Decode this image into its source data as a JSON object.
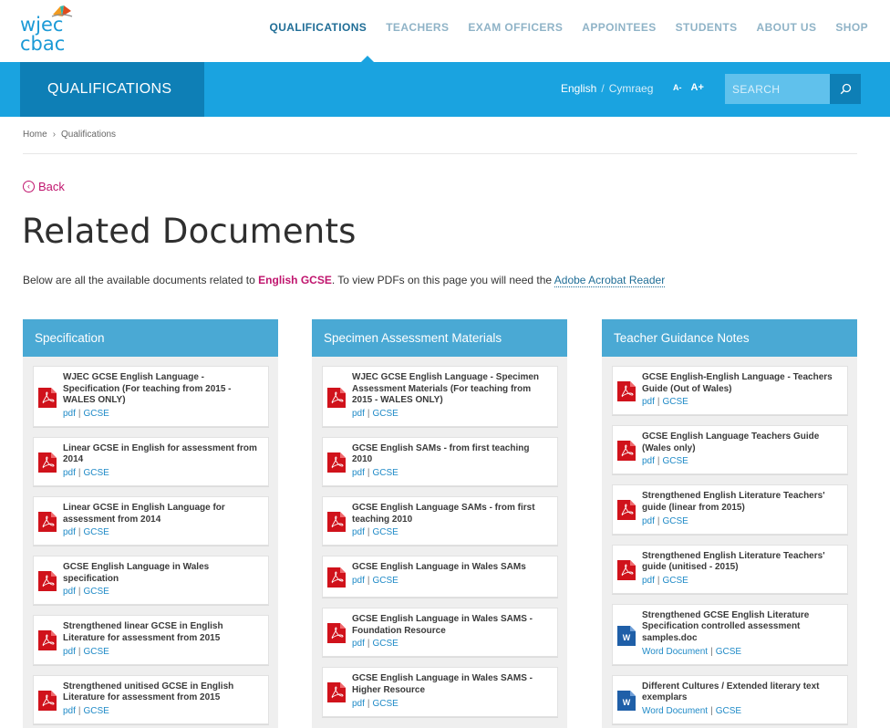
{
  "logo": {
    "line1": "wjec",
    "line2": "cbac"
  },
  "nav": [
    "QUALIFICATIONS",
    "TEACHERS",
    "EXAM OFFICERS",
    "APPOINTEES",
    "STUDENTS",
    "ABOUT US",
    "SHOP"
  ],
  "band": {
    "title": "QUALIFICATIONS",
    "lang_current": "English",
    "lang_sep": "/",
    "lang_alt": "Cymraeg",
    "font_smaller": "A-",
    "font_larger": "A+",
    "search_placeholder": "SEARCH"
  },
  "breadcrumb": [
    "Home",
    "Qualifications"
  ],
  "back_label": "Back",
  "page_title": "Related Documents",
  "intro": {
    "before": "Below are all the available documents related to ",
    "subject": "English GCSE",
    "middle": ". To view PDFs on this page you will need the ",
    "link": "Adobe Acrobat Reader"
  },
  "columns": [
    {
      "heading": "Specification",
      "items": [
        {
          "icon": "pdf-icon",
          "title": "WJEC GCSE English Language - Specification (For teaching from 2015 - WALES ONLY)",
          "type": "pdf",
          "tag": "GCSE"
        },
        {
          "icon": "pdf-icon",
          "title": "Linear GCSE in English for assessment from 2014",
          "type": "pdf",
          "tag": "GCSE"
        },
        {
          "icon": "pdf-icon",
          "title": "Linear GCSE in English Language for assessment from 2014",
          "type": "pdf",
          "tag": "GCSE"
        },
        {
          "icon": "pdf-icon",
          "title": "GCSE English Language in Wales specification",
          "type": "pdf",
          "tag": "GCSE"
        },
        {
          "icon": "pdf-icon",
          "title": "Strengthened linear GCSE in English Literature for assessment from 2015",
          "type": "pdf",
          "tag": "GCSE"
        },
        {
          "icon": "pdf-icon",
          "title": "Strengthened unitised GCSE in English Literature for assessment from 2015",
          "type": "pdf",
          "tag": "GCSE"
        }
      ]
    },
    {
      "heading": "Specimen Assessment Materials",
      "items": [
        {
          "icon": "pdf-icon",
          "title": "WJEC GCSE English Language - Specimen Assessment Materials (For teaching from 2015 - WALES ONLY)",
          "type": "pdf",
          "tag": "GCSE"
        },
        {
          "icon": "pdf-icon",
          "title": "GCSE English SAMs - from first teaching 2010",
          "type": "pdf",
          "tag": "GCSE"
        },
        {
          "icon": "pdf-icon",
          "title": "GCSE English Language SAMs - from first teaching 2010",
          "type": "pdf",
          "tag": "GCSE"
        },
        {
          "icon": "pdf-icon",
          "title": "GCSE English Language in Wales SAMs",
          "type": "pdf",
          "tag": "GCSE"
        },
        {
          "icon": "pdf-icon",
          "title": "GCSE English Language in Wales SAMS - Foundation Resource",
          "type": "pdf",
          "tag": "GCSE"
        },
        {
          "icon": "pdf-icon",
          "title": "GCSE English Language in Wales SAMS - Higher Resource",
          "type": "pdf",
          "tag": "GCSE"
        }
      ]
    },
    {
      "heading": "Teacher Guidance Notes",
      "items": [
        {
          "icon": "pdf-icon",
          "title": "GCSE English-English Language - Teachers Guide (Out of Wales)",
          "type": "pdf",
          "tag": "GCSE"
        },
        {
          "icon": "pdf-icon",
          "title": "GCSE English Language Teachers Guide (Wales only)",
          "type": "pdf",
          "tag": "GCSE"
        },
        {
          "icon": "pdf-icon",
          "title": "Strengthened English Literature Teachers' guide (linear from 2015)",
          "type": "pdf",
          "tag": "GCSE"
        },
        {
          "icon": "pdf-icon",
          "title": "Strengthened English Literature Teachers' guide (unitised - 2015)",
          "type": "pdf",
          "tag": "GCSE"
        },
        {
          "icon": "word-icon",
          "title": "Strengthened GCSE English Literature Specification controlled assessment samples.doc",
          "type": "Word Document",
          "tag": "GCSE"
        },
        {
          "icon": "word-icon",
          "title": "Different Cultures / Extended literary text exemplars",
          "type": "Word Document",
          "tag": "GCSE"
        }
      ]
    }
  ],
  "colors": {
    "brand_blue": "#1aa3e0",
    "dark_blue": "#0e7fb6",
    "column_head": "#4aa9d4",
    "accent_magenta": "#c0156e",
    "pdf_red": "#d0121b",
    "word_blue": "#1f5fa8"
  }
}
